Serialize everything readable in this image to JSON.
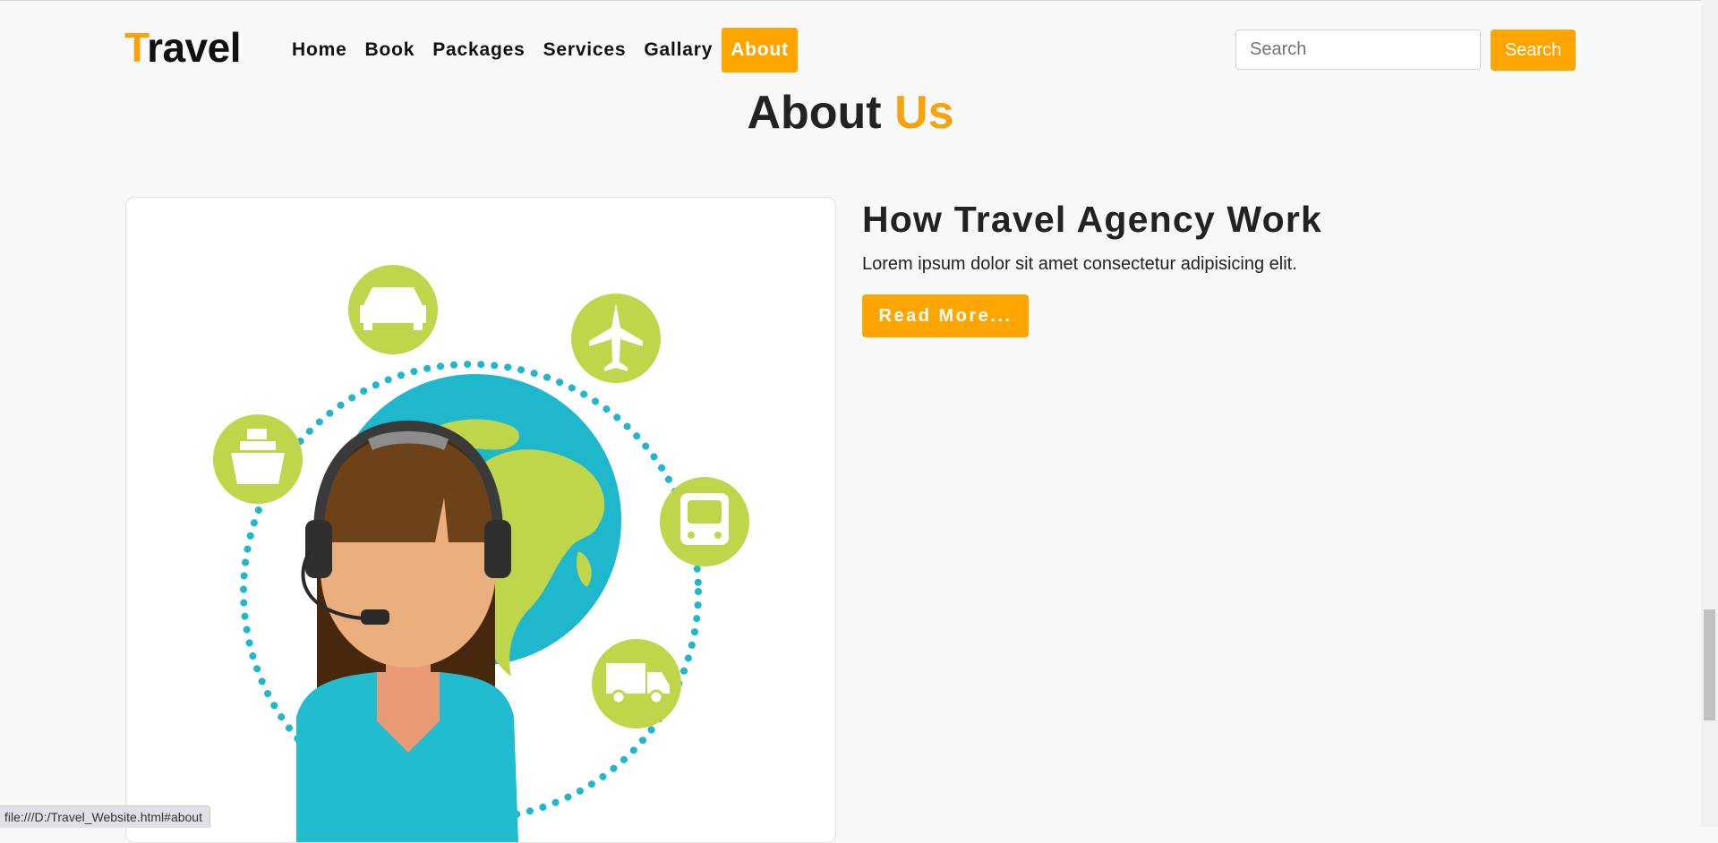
{
  "brand": {
    "first_letter": "T",
    "rest": "ravel"
  },
  "nav": {
    "items": [
      {
        "label": "Home"
      },
      {
        "label": "Book"
      },
      {
        "label": "Packages"
      },
      {
        "label": "Services"
      },
      {
        "label": "Gallary"
      },
      {
        "label": "About",
        "active": true
      }
    ]
  },
  "search": {
    "placeholder": "Search",
    "button_label": "Search"
  },
  "section": {
    "title_main": "About",
    "title_accent": "Us"
  },
  "about": {
    "title": "How Travel Agency Work",
    "text": "Lorem ipsum dolor sit amet consectetur adipisicing elit.",
    "button_label": "Read More..."
  },
  "status_bar": {
    "url": "file:///D:/Travel_Website.html#about"
  },
  "colors": {
    "accent": "#ffa500",
    "icon_circle": "#bfd64b",
    "globe": "#1fb7cc",
    "shirt": "#21bccf"
  }
}
